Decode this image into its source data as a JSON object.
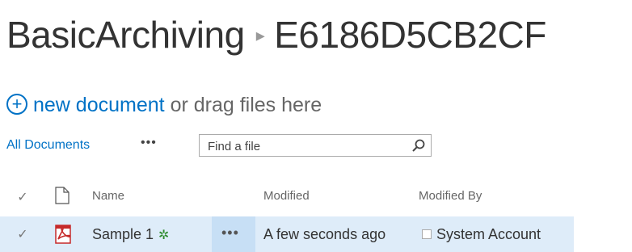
{
  "breadcrumb": {
    "library": "BasicArchiving",
    "folder": "E6186D5CB2CF"
  },
  "new_document": {
    "link_label": "new document",
    "rest_label": "or drag files here"
  },
  "views": {
    "current": "All Documents",
    "more": "•••"
  },
  "search": {
    "placeholder": "Find a file"
  },
  "columns": {
    "check": "✓",
    "name": "Name",
    "modified": "Modified",
    "modified_by": "Modified By"
  },
  "rows": [
    {
      "check": "✓",
      "name": "Sample 1",
      "new_marker": "✲",
      "actions": "•••",
      "modified": "A few seconds ago",
      "modified_by": "System Account",
      "file_type_icon": "pdf-icon"
    }
  ],
  "colors": {
    "link": "#0072c6",
    "selected_row": "#deecf9",
    "pdf": "#c62a2a",
    "new_marker": "#2e8b2e"
  }
}
